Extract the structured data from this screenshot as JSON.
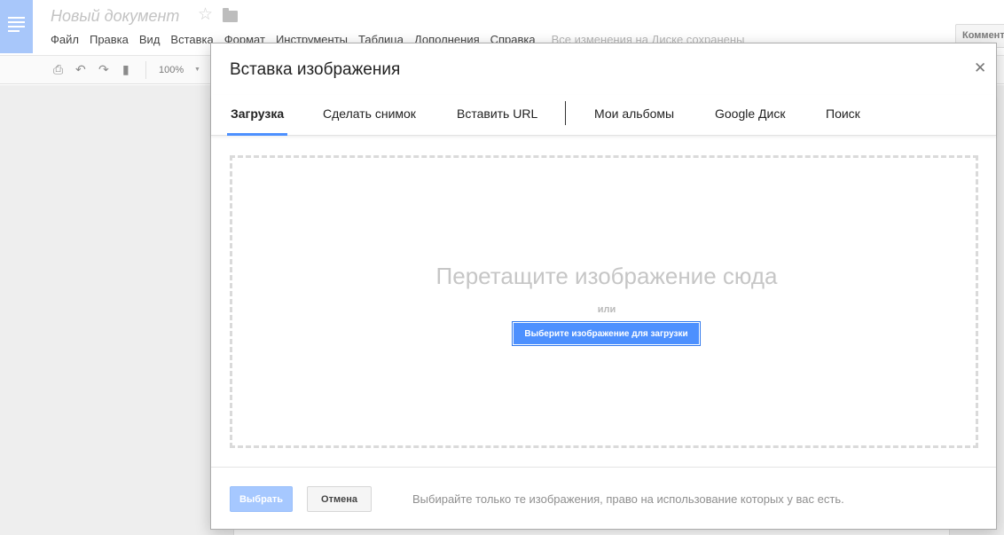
{
  "app": {
    "doc_title": "Новый документ",
    "icons": {
      "logo": "docs-logo-icon",
      "star": "star-icon",
      "folder": "folder-icon"
    }
  },
  "menu": {
    "items": [
      "Файл",
      "Правка",
      "Вид",
      "Вставка",
      "Формат",
      "Инструменты",
      "Таблица",
      "Дополнения",
      "Справка"
    ],
    "save_status": "Все изменения на Диске сохранены"
  },
  "header": {
    "comments_label": "Коммент"
  },
  "toolbar": {
    "zoom": "100%",
    "icons": [
      "print-icon",
      "undo-icon",
      "redo-icon",
      "paint-format-icon",
      "dropdown-caret-icon"
    ]
  },
  "dialog": {
    "title": "Вставка изображения",
    "close_icon": "close-icon",
    "tabs": [
      {
        "label": "Загрузка",
        "active": true
      },
      {
        "label": "Сделать снимок",
        "active": false
      },
      {
        "label": "Вставить URL",
        "active": false
      },
      {
        "label": "Мои альбомы",
        "active": false
      },
      {
        "label": "Google Диск",
        "active": false
      },
      {
        "label": "Поиск",
        "active": false
      }
    ],
    "dropzone": {
      "title": "Перетащите изображение сюда",
      "or": "или",
      "button": "Выберите изображение для загрузки"
    },
    "footer": {
      "select_label": "Выбрать",
      "cancel_label": "Отмена",
      "note": "Выбирайте только те изображения, право на использование которых у вас есть."
    }
  },
  "colors": {
    "accent": "#4d90fe",
    "disabled_button": "#a6c8ff",
    "logo": "#a8c7fa"
  }
}
